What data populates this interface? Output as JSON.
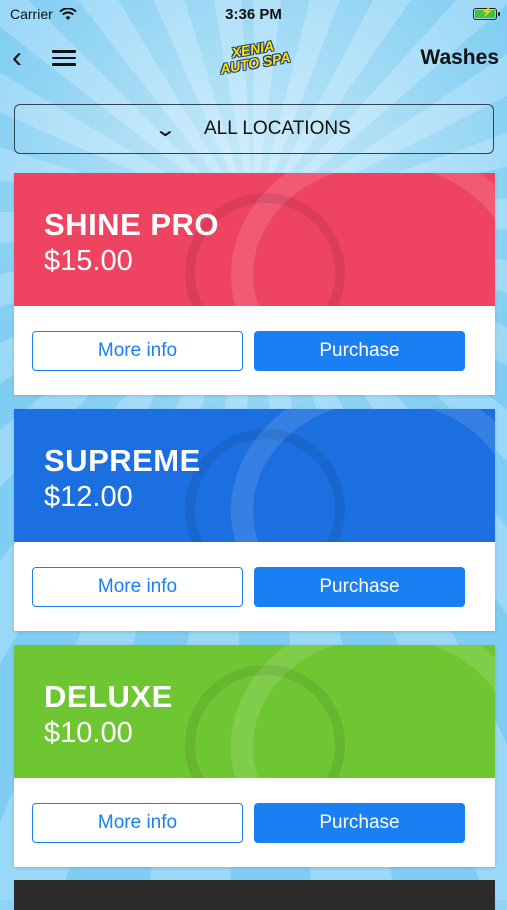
{
  "status": {
    "carrier": "Carrier",
    "time": "3:36 PM"
  },
  "nav": {
    "logo_line1": "XENIA",
    "logo_line2": "AUTO SPA",
    "title": "Washes"
  },
  "location": {
    "label": "ALL LOCATIONS"
  },
  "washes": [
    {
      "name": "SHINE PRO",
      "price": "$15.00",
      "color": "#ee4462",
      "more_info": "More info",
      "purchase": "Purchase"
    },
    {
      "name": "SUPREME",
      "price": "$12.00",
      "color": "#1b6fe0",
      "more_info": "More info",
      "purchase": "Purchase"
    },
    {
      "name": "DELUXE",
      "price": "$10.00",
      "color": "#6fc633",
      "more_info": "More info",
      "purchase": "Purchase"
    }
  ],
  "colors": {
    "accent": "#1a7ff2",
    "background": "#8fd3f5"
  }
}
